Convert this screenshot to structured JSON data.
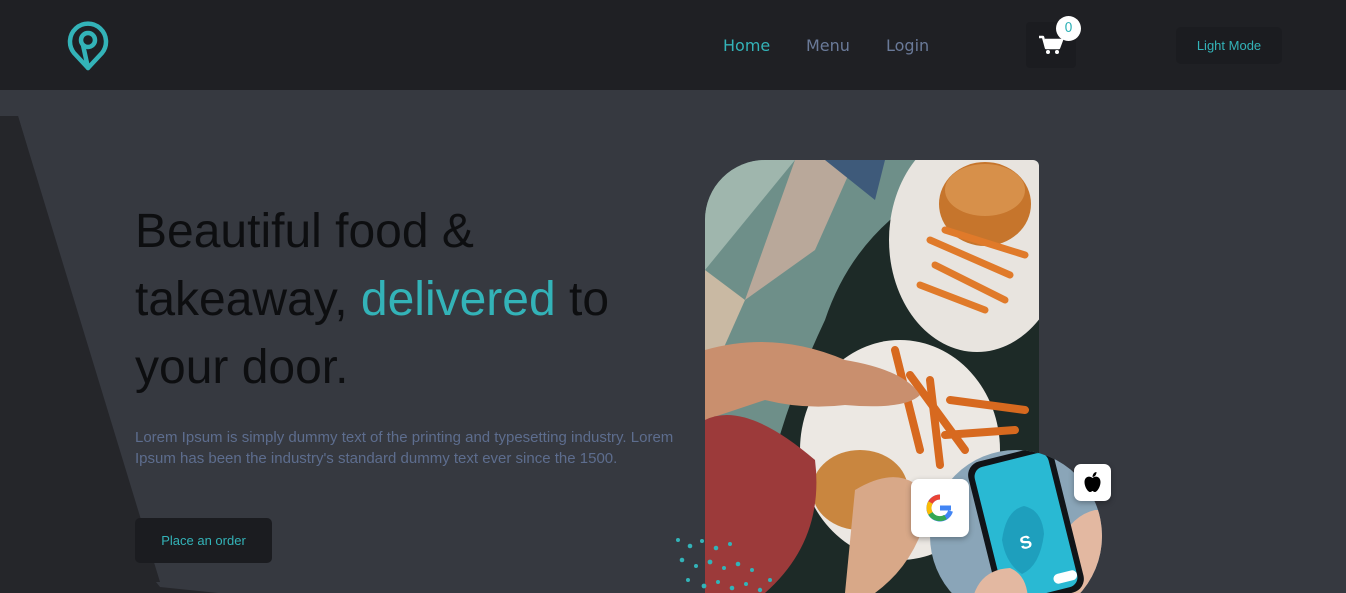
{
  "colors": {
    "accent": "#33b3b8",
    "nav_inactive": "#6a7a99",
    "header_bg": "#1f2024",
    "hero_bg": "#363940",
    "hero_shape": "#25262a",
    "title_text": "#0d0e10",
    "desc_text": "#5d6d8e",
    "button_bg": "#1b1c20"
  },
  "header": {
    "logo_icon": "map-pin-logo-icon",
    "nav": {
      "home": "Home",
      "menu": "Menu",
      "login": "Login"
    },
    "cart": {
      "icon": "shopping-cart-icon",
      "count": "0"
    },
    "mode_button": "Light Mode"
  },
  "hero": {
    "title_before": "Beautiful food & takeaway, ",
    "title_highlight": "delivered",
    "title_after": " to your door.",
    "description": "Lorem Ipsum is simply dummy text of the printing and typesetting industry. Lorem Ipsum has been the industry's standard dummy text ever since the 1500.",
    "cta": "Place an order"
  },
  "illustration": {
    "food_image": "burger-and-fries-photo",
    "phone_image": "hand-holding-phone-photo",
    "badges": [
      "google-icon",
      "apple-icon"
    ]
  }
}
